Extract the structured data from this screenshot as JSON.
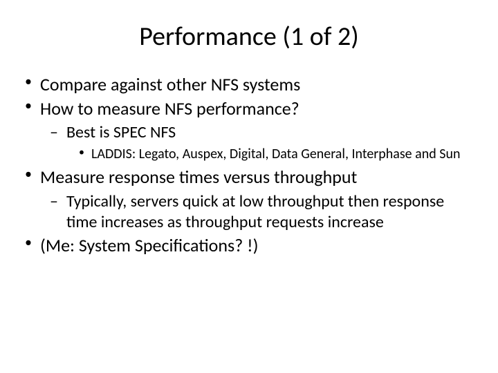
{
  "title": "Performance (1 of 2)",
  "bullets": {
    "b1": "Compare against other NFS systems",
    "b2": "How to measure NFS performance?",
    "b2_1": "Best is SPEC NFS",
    "b2_1_1": "LADDIS: Legato, Auspex, Digital, Data General, Interphase and Sun",
    "b3": "Measure response times versus throughput",
    "b3_1": "Typically, servers quick at low throughput then response time increases as throughput requests increase",
    "b4": "(Me: System Specifications? !)"
  }
}
